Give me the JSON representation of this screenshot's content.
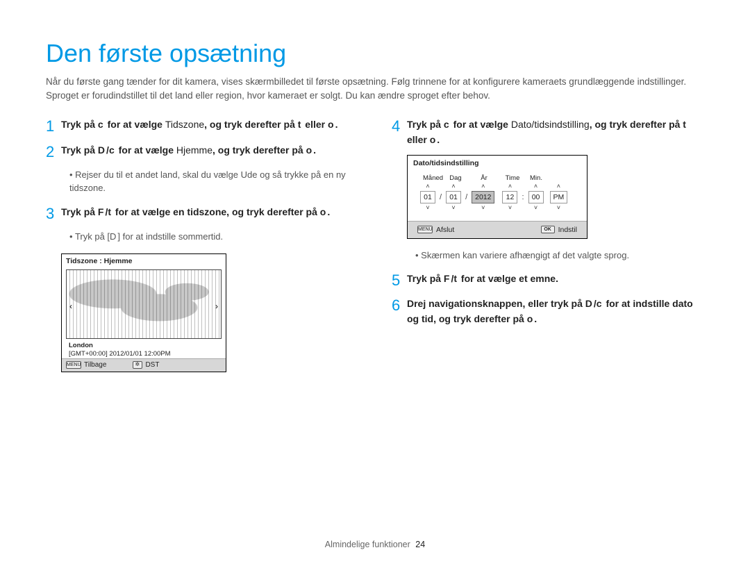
{
  "title": "Den første opsætning",
  "intro": "Når du første gang tænder for dit kamera, vises skærmbilledet til første opsætning. Følg trinnene for at konfigurere kameraets grundlæggende indstillinger. Sproget er forudindstillet til det land eller region, hvor kameraet er solgt. Du kan ændre sproget efter behov.",
  "steps": {
    "s1": {
      "pre": "Tryk på ",
      "g1": "c",
      "mid1": " for at vælge ",
      "kw": "Tidszone",
      "mid2": ", og tryk derefter på ",
      "g2": "t",
      "mid3": " eller ",
      "g3": "o",
      "end": "."
    },
    "s2": {
      "pre": "Tryk på ",
      "g1": "D",
      "mid1": "/",
      "g2": "c",
      "mid2": " for at vælge ",
      "kw": "Hjemme",
      "mid3": ", og tryk derefter på ",
      "g3": "o",
      "end": "."
    },
    "s2sub": "Rejser du til et andet land, skal du vælge Ude og så trykke på en ny tidszone.",
    "s3": {
      "pre": "Tryk på ",
      "g1": "F",
      "mid1": "/",
      "g2": "t",
      "mid2": " for at vælge en tidszone, og tryk derefter på ",
      "g3": "o",
      "end": "."
    },
    "s3sub": {
      "a": "Tryk på [",
      "g": "D",
      "b": "] for at indstille sommertid."
    },
    "s4": {
      "pre": "Tryk på ",
      "g1": "c",
      "mid1": " for at vælge ",
      "kw": "Dato/tidsindstilling",
      "mid2": ", og tryk derefter på ",
      "g2": "t",
      "mid3": " eller ",
      "g3": "o",
      "end": "."
    },
    "s4sub": "Skærmen kan variere afhængigt af det valgte sprog.",
    "s5": {
      "pre": "Tryk på ",
      "g1": "F",
      "mid1": "/",
      "g2": "t",
      "mid2": " for at vælge et emne."
    },
    "s6": {
      "a": "Drej navigationsknappen, eller tryk på ",
      "g1": "D",
      "b": "/",
      "g2": "c",
      "c": " for at indstille dato og tid, og tryk derefter på ",
      "g3": "o",
      "d": "."
    }
  },
  "tz": {
    "header": "Tidszone : Hjemme",
    "city": "London",
    "stamp": "[GMT+00:00] 2012/01/01 12:00PM",
    "back": "Tilbage",
    "dst": "DST"
  },
  "dt": {
    "header": "Dato/tidsindstilling",
    "labels": {
      "month": "Måned",
      "day": "Dag",
      "year": "År",
      "hour": "Time",
      "min": "Min."
    },
    "vals": {
      "month": "01",
      "day": "01",
      "year": "2012",
      "hour": "12",
      "min": "00",
      "ampm": "PM"
    },
    "exit": "Afslut",
    "set": "Indstil",
    "menu": "MENU",
    "ok": "OK"
  },
  "footer": {
    "label": "Almindelige funktioner",
    "page": "24"
  }
}
